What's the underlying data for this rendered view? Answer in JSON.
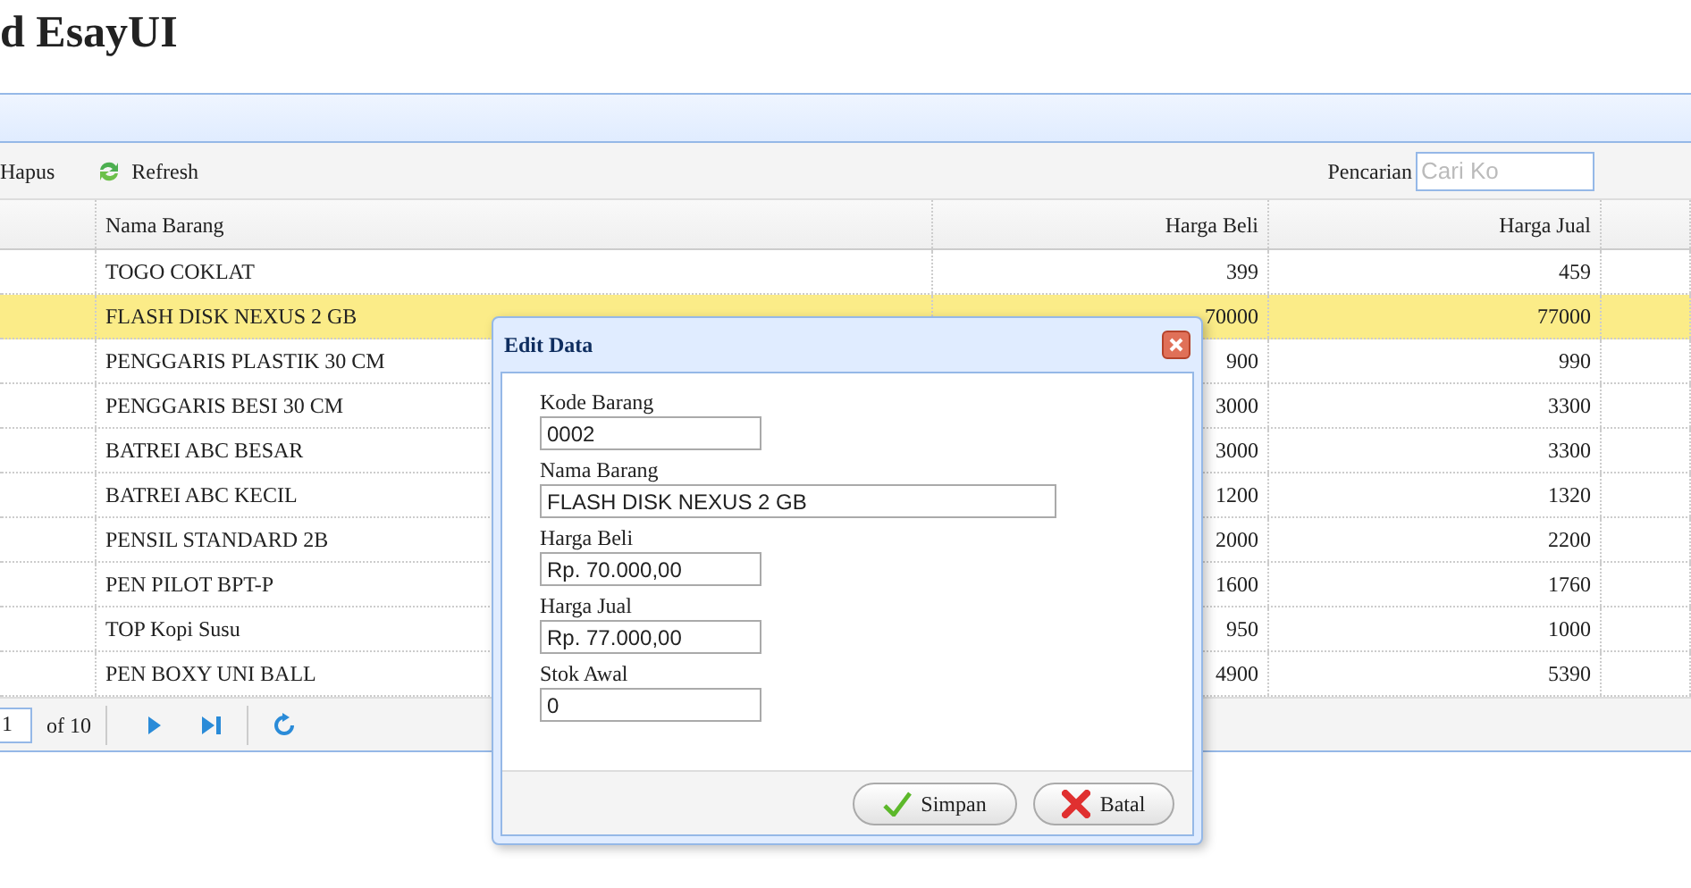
{
  "page_title": "d EsayUI",
  "toolbar": {
    "buttons": [
      {
        "kind": "plain",
        "label": "Hapus"
      },
      {
        "kind": "refresh",
        "label": "Refresh"
      }
    ],
    "search_label": "Pencarian",
    "search": {
      "placeholder": "Cari Ko"
    }
  },
  "table": {
    "columns": [
      "",
      "Nama Barang",
      "Harga Beli",
      "Harga Jual",
      ""
    ],
    "rows": [
      {
        "selected": false,
        "cells": [
          "",
          "TOGO COKLAT",
          "399",
          "459",
          ""
        ]
      },
      {
        "selected": true,
        "cells": [
          "",
          "FLASH DISK NEXUS 2 GB",
          "70000",
          "77000",
          ""
        ]
      },
      {
        "selected": false,
        "cells": [
          "",
          "PENGGARIS PLASTIK 30 CM",
          "900",
          "990",
          ""
        ]
      },
      {
        "selected": false,
        "cells": [
          "",
          "PENGGARIS BESI 30 CM",
          "3000",
          "3300",
          ""
        ]
      },
      {
        "selected": false,
        "cells": [
          "",
          "BATREI ABC BESAR",
          "3000",
          "3300",
          ""
        ]
      },
      {
        "selected": false,
        "cells": [
          "",
          "BATREI ABC KECIL",
          "1200",
          "1320",
          ""
        ]
      },
      {
        "selected": false,
        "cells": [
          "",
          "PENSIL STANDARD 2B",
          "2000",
          "2200",
          ""
        ]
      },
      {
        "selected": false,
        "cells": [
          "",
          "PEN PILOT BPT-P",
          "1600",
          "1760",
          ""
        ]
      },
      {
        "selected": false,
        "cells": [
          "",
          "TOP Kopi Susu",
          "950",
          "1000",
          ""
        ]
      },
      {
        "selected": false,
        "cells": [
          "",
          "PEN BOXY UNI BALL",
          "4900",
          "5390",
          ""
        ]
      }
    ]
  },
  "pager": {
    "page": "1",
    "of": "of 10"
  },
  "dialog": {
    "title": "Edit Data",
    "fields": [
      {
        "label": "Kode Barang",
        "value": "0002",
        "kind": "short"
      },
      {
        "label": "Nama Barang",
        "value": "FLASH DISK NEXUS 2 GB",
        "kind": "long"
      },
      {
        "label": "Harga Beli",
        "value": "Rp. 70.000,00",
        "kind": "short"
      },
      {
        "label": "Harga Jual",
        "value": "Rp. 77.000,00",
        "kind": "short"
      },
      {
        "label": "Stok Awal",
        "value": "0",
        "kind": "short"
      }
    ],
    "buttons": [
      {
        "kind": "save",
        "label": "Simpan"
      },
      {
        "kind": "cancel",
        "label": "Batal"
      }
    ]
  }
}
